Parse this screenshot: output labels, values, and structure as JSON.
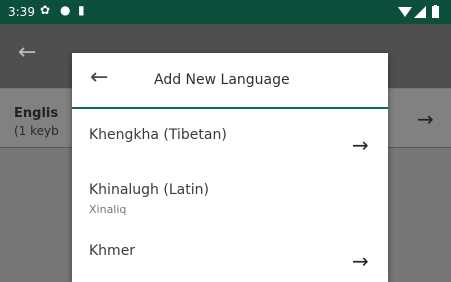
{
  "status": {
    "time": "3:39",
    "icons": [
      "settings-icon",
      "location-icon",
      "sdcard-icon"
    ],
    "right_icons": [
      "wifi-icon",
      "signal-icon",
      "battery-icon"
    ]
  },
  "background": {
    "language_name": "Englis",
    "language_sub": "(1 keyb"
  },
  "dialog": {
    "title": "Add New Language",
    "items": [
      {
        "name": "Khengkha (Tibetan)",
        "sub": "",
        "arrow": "→"
      },
      {
        "name": "Khinalugh (Latin)",
        "sub": "Xinaliq",
        "arrow": ""
      },
      {
        "name": "Khmer",
        "sub": "",
        "arrow": "→"
      }
    ]
  },
  "glyphs": {
    "back": "←",
    "forward": "→"
  },
  "colors": {
    "statusbar": "#0b4f3c",
    "accent": "#0b6b54",
    "scrim": "#767676"
  }
}
